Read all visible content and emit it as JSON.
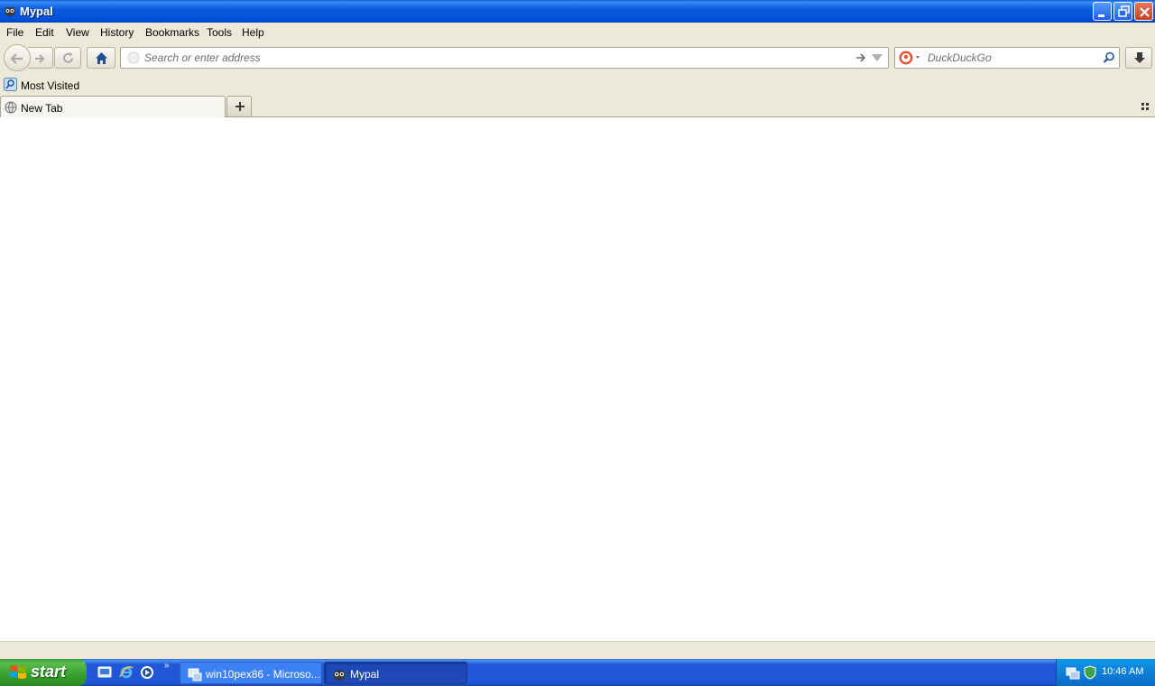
{
  "window": {
    "title": "Mypal"
  },
  "menu": {
    "items": [
      {
        "label": "File"
      },
      {
        "label": "Edit"
      },
      {
        "label": "View"
      },
      {
        "label": "History"
      },
      {
        "label": "Bookmarks"
      },
      {
        "label": "Tools"
      },
      {
        "label": "Help"
      }
    ]
  },
  "navbar": {
    "url_value": "",
    "url_placeholder": "Search or enter address",
    "search_value": "",
    "search_placeholder": "DuckDuckGo"
  },
  "bookmarks": {
    "items": [
      {
        "label": "Most Visited"
      }
    ]
  },
  "tabs": [
    {
      "label": "New Tab",
      "active": true
    }
  ],
  "taskbar": {
    "start_label": "start",
    "items": [
      {
        "label": "win10pex86 - Microso..."
      },
      {
        "label": "Mypal"
      }
    ],
    "clock": "10:46 AM"
  },
  "colors": {
    "titlebar": "#0B5BE0",
    "chrome": "#ECE9D8",
    "taskbar": "#2157D7",
    "start": "#36A02E"
  }
}
